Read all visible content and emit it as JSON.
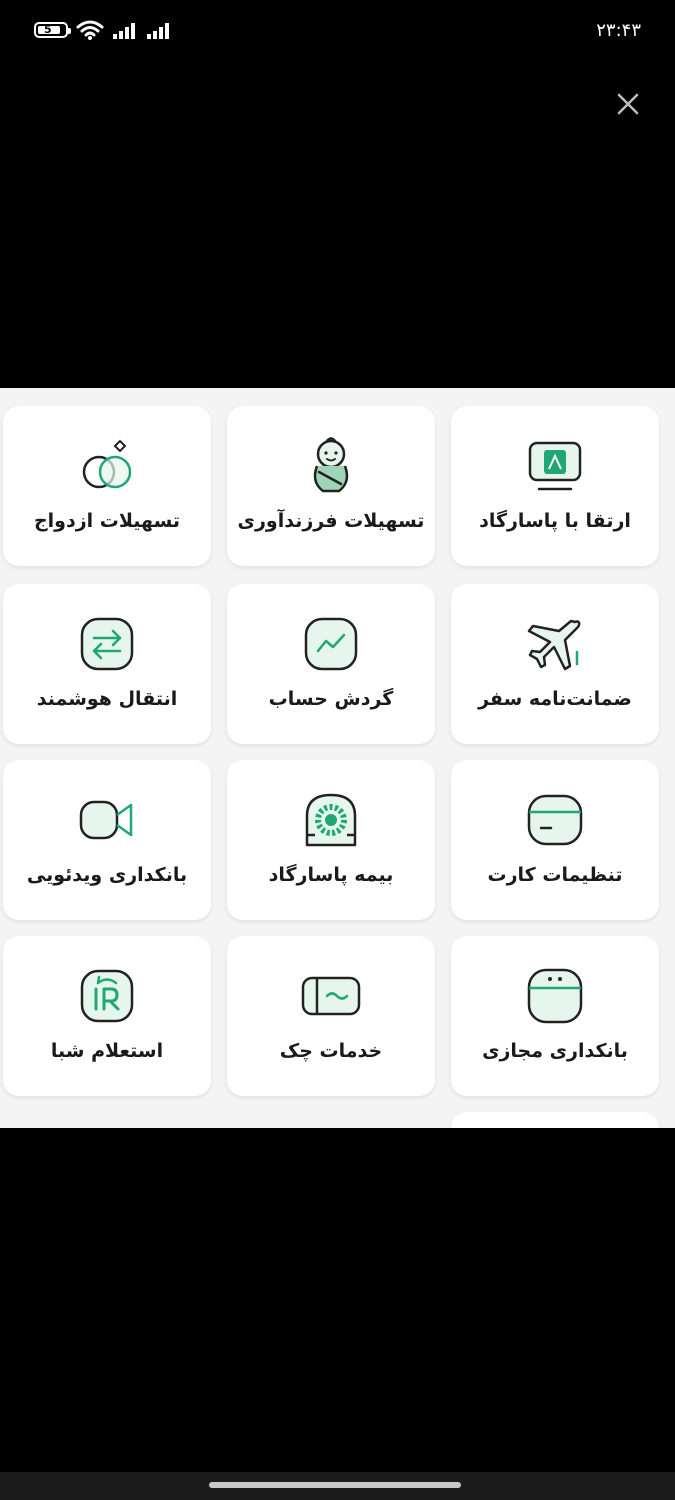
{
  "status_bar": {
    "time": "۲۳:۴۳",
    "battery_level": "5"
  },
  "colors": {
    "accent": "#1fa774",
    "accent_light": "#e6f6ee",
    "sheet_bg": "#f4f4f4",
    "card_bg": "#ffffff"
  },
  "tiles": [
    {
      "label": "ارتقا با پاسارگاد",
      "icon": "upgrade-monitor-icon"
    },
    {
      "label": "تسهیلات فرزندآوری",
      "icon": "baby-icon"
    },
    {
      "label": "تسهیلات ازدواج",
      "icon": "rings-icon"
    },
    {
      "label": "ضمانت‌نامه سفر",
      "icon": "airplane-icon"
    },
    {
      "label": "گردش حساب",
      "icon": "account-turnover-icon"
    },
    {
      "label": "انتقال هوشمند",
      "icon": "smart-transfer-icon"
    },
    {
      "label": "تنظیمات کارت",
      "icon": "card-settings-icon"
    },
    {
      "label": "بیمه پاسارگاد",
      "icon": "insurance-icon"
    },
    {
      "label": "بانکداری ویدئویی",
      "icon": "video-banking-icon"
    },
    {
      "label": "بانکداری مجازی",
      "icon": "virtual-banking-icon"
    },
    {
      "label": "خدمات چک",
      "icon": "cheque-icon"
    },
    {
      "label": "استعلام شبا",
      "icon": "sheba-inquiry-icon"
    }
  ]
}
